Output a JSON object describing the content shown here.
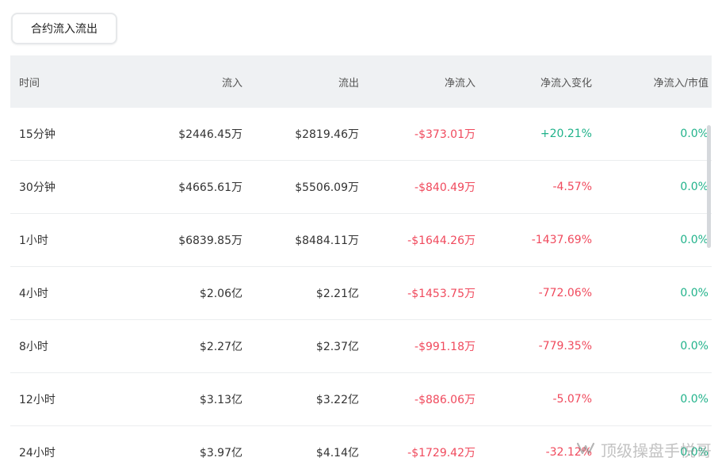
{
  "tab": {
    "label": "合约流入流出"
  },
  "table": {
    "columns": [
      "时间",
      "流入",
      "流出",
      "净流入",
      "净流入变化",
      "净流入/市值"
    ],
    "rows": [
      {
        "time": "15分钟",
        "inflow": "$2446.45万",
        "outflow": "$2819.46万",
        "net": "-$373.01万",
        "change": "+20.21%",
        "ratio": "0.0%"
      },
      {
        "time": "30分钟",
        "inflow": "$4665.61万",
        "outflow": "$5506.09万",
        "net": "-$840.49万",
        "change": "-4.57%",
        "ratio": "0.0%"
      },
      {
        "time": "1小时",
        "inflow": "$6839.85万",
        "outflow": "$8484.11万",
        "net": "-$1644.26万",
        "change": "-1437.69%",
        "ratio": "0.0%"
      },
      {
        "time": "4小时",
        "inflow": "$2.06亿",
        "outflow": "$2.21亿",
        "net": "-$1453.75万",
        "change": "-772.06%",
        "ratio": "0.0%"
      },
      {
        "time": "8小时",
        "inflow": "$2.27亿",
        "outflow": "$2.37亿",
        "net": "-$991.18万",
        "change": "-779.35%",
        "ratio": "0.0%"
      },
      {
        "time": "12小时",
        "inflow": "$3.13亿",
        "outflow": "$3.22亿",
        "net": "-$886.06万",
        "change": "-5.07%",
        "ratio": "0.0%"
      },
      {
        "time": "24小时",
        "inflow": "$3.97亿",
        "outflow": "$4.14亿",
        "net": "-$1729.42万",
        "change": "-32.12%",
        "ratio": "0.0%"
      }
    ]
  },
  "watermark": {
    "text": "顶级操盘手悦哥",
    "icon": "wechat-channel-icon"
  },
  "colors": {
    "negative": "#f04a5d",
    "positive": "#20b28a",
    "header_bg": "#eff1f3"
  }
}
